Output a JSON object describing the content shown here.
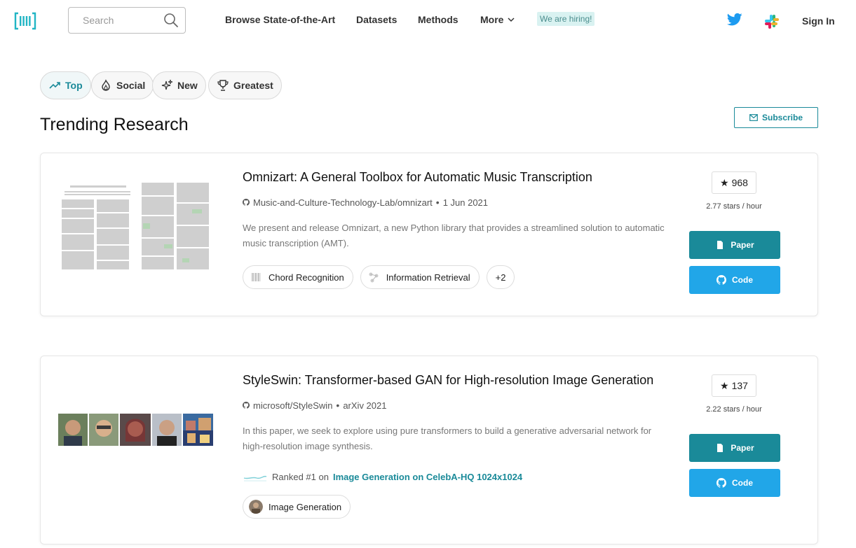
{
  "nav": {
    "logo_icon": "pwc-logo-icon",
    "search_placeholder": "Search",
    "links": [
      "Browse State-of-the-Art",
      "Datasets",
      "Methods",
      "More"
    ],
    "hiring": "We are hiring!",
    "signin": "Sign In"
  },
  "filters": [
    {
      "label": "Top",
      "icon": "trend-icon",
      "active": true
    },
    {
      "label": "Social",
      "icon": "flame-icon",
      "active": false
    },
    {
      "label": "New",
      "icon": "sparkle-icon",
      "active": false
    },
    {
      "label": "Greatest",
      "icon": "trophy-icon",
      "active": false
    }
  ],
  "page_title": "Trending Research",
  "subscribe_label": "Subscribe",
  "colors": {
    "accent": "#1a8a99",
    "code_button": "#21a6e8",
    "hiring_bg": "#d9f2f1"
  },
  "papers": [
    {
      "title": "Omnizart: A General Toolbox for Automatic Music Transcription",
      "repo": "Music-and-Culture-Technology-Lab/omnizart",
      "date": "1 Jun 2021",
      "abstract_line1": "We present and release Omnizart, a new Python library that provides a streamlined solution to automatic",
      "abstract_line2": "music transcription (AMT).",
      "tags": [
        "Chord Recognition",
        "Information Retrieval"
      ],
      "more_tags": "+2",
      "stars": "968",
      "stars_rate": "2.77 stars / hour",
      "paper_btn": "Paper",
      "code_btn": "Code"
    },
    {
      "title": "StyleSwin: Transformer-based GAN for High-resolution Image Generation",
      "repo": "microsoft/StyleSwin",
      "date": "arXiv 2021",
      "abstract_line1": "In this paper, we seek to explore using pure transformers to build a generative adversarial network for",
      "abstract_line2": "high-resolution image synthesis.",
      "ranked_prefix": "Ranked #1 on",
      "ranked_link": "Image Generation on CelebA-HQ 1024x1024",
      "tags": [
        "Image Generation"
      ],
      "stars": "137",
      "stars_rate": "2.22 stars / hour",
      "paper_btn": "Paper",
      "code_btn": "Code"
    }
  ]
}
